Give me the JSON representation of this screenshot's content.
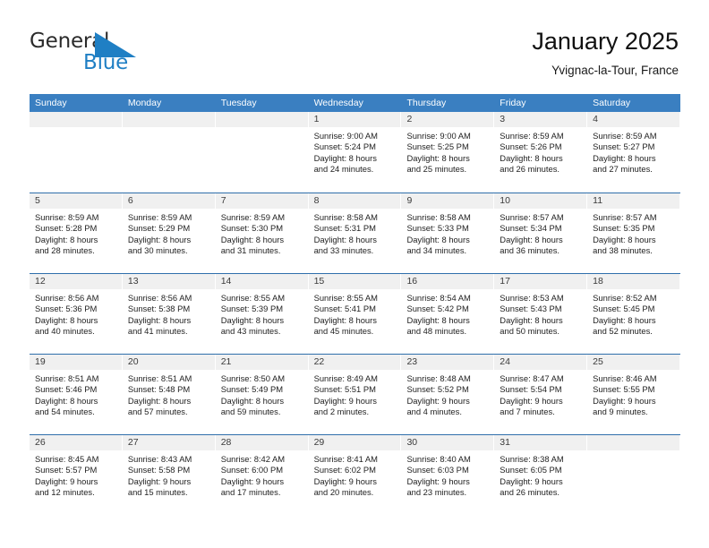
{
  "brand": {
    "name_part1": "General",
    "name_part2": "Blue",
    "triangle_color": "#1f7fc4",
    "text_color": "#2b2b2b"
  },
  "header": {
    "title": "January 2025",
    "location": "Yvignac-la-Tour, France"
  },
  "theme": {
    "header_blue": "#3a7fc1",
    "rule_blue": "#2f6fab",
    "band_gray": "#f0f0f0"
  },
  "weekdays": [
    "Sunday",
    "Monday",
    "Tuesday",
    "Wednesday",
    "Thursday",
    "Friday",
    "Saturday"
  ],
  "weeks": [
    [
      {
        "day": "",
        "lines": []
      },
      {
        "day": "",
        "lines": []
      },
      {
        "day": "",
        "lines": []
      },
      {
        "day": "1",
        "lines": [
          "Sunrise: 9:00 AM",
          "Sunset: 5:24 PM",
          "Daylight: 8 hours",
          "and 24 minutes."
        ]
      },
      {
        "day": "2",
        "lines": [
          "Sunrise: 9:00 AM",
          "Sunset: 5:25 PM",
          "Daylight: 8 hours",
          "and 25 minutes."
        ]
      },
      {
        "day": "3",
        "lines": [
          "Sunrise: 8:59 AM",
          "Sunset: 5:26 PM",
          "Daylight: 8 hours",
          "and 26 minutes."
        ]
      },
      {
        "day": "4",
        "lines": [
          "Sunrise: 8:59 AM",
          "Sunset: 5:27 PM",
          "Daylight: 8 hours",
          "and 27 minutes."
        ]
      }
    ],
    [
      {
        "day": "5",
        "lines": [
          "Sunrise: 8:59 AM",
          "Sunset: 5:28 PM",
          "Daylight: 8 hours",
          "and 28 minutes."
        ]
      },
      {
        "day": "6",
        "lines": [
          "Sunrise: 8:59 AM",
          "Sunset: 5:29 PM",
          "Daylight: 8 hours",
          "and 30 minutes."
        ]
      },
      {
        "day": "7",
        "lines": [
          "Sunrise: 8:59 AM",
          "Sunset: 5:30 PM",
          "Daylight: 8 hours",
          "and 31 minutes."
        ]
      },
      {
        "day": "8",
        "lines": [
          "Sunrise: 8:58 AM",
          "Sunset: 5:31 PM",
          "Daylight: 8 hours",
          "and 33 minutes."
        ]
      },
      {
        "day": "9",
        "lines": [
          "Sunrise: 8:58 AM",
          "Sunset: 5:33 PM",
          "Daylight: 8 hours",
          "and 34 minutes."
        ]
      },
      {
        "day": "10",
        "lines": [
          "Sunrise: 8:57 AM",
          "Sunset: 5:34 PM",
          "Daylight: 8 hours",
          "and 36 minutes."
        ]
      },
      {
        "day": "11",
        "lines": [
          "Sunrise: 8:57 AM",
          "Sunset: 5:35 PM",
          "Daylight: 8 hours",
          "and 38 minutes."
        ]
      }
    ],
    [
      {
        "day": "12",
        "lines": [
          "Sunrise: 8:56 AM",
          "Sunset: 5:36 PM",
          "Daylight: 8 hours",
          "and 40 minutes."
        ]
      },
      {
        "day": "13",
        "lines": [
          "Sunrise: 8:56 AM",
          "Sunset: 5:38 PM",
          "Daylight: 8 hours",
          "and 41 minutes."
        ]
      },
      {
        "day": "14",
        "lines": [
          "Sunrise: 8:55 AM",
          "Sunset: 5:39 PM",
          "Daylight: 8 hours",
          "and 43 minutes."
        ]
      },
      {
        "day": "15",
        "lines": [
          "Sunrise: 8:55 AM",
          "Sunset: 5:41 PM",
          "Daylight: 8 hours",
          "and 45 minutes."
        ]
      },
      {
        "day": "16",
        "lines": [
          "Sunrise: 8:54 AM",
          "Sunset: 5:42 PM",
          "Daylight: 8 hours",
          "and 48 minutes."
        ]
      },
      {
        "day": "17",
        "lines": [
          "Sunrise: 8:53 AM",
          "Sunset: 5:43 PM",
          "Daylight: 8 hours",
          "and 50 minutes."
        ]
      },
      {
        "day": "18",
        "lines": [
          "Sunrise: 8:52 AM",
          "Sunset: 5:45 PM",
          "Daylight: 8 hours",
          "and 52 minutes."
        ]
      }
    ],
    [
      {
        "day": "19",
        "lines": [
          "Sunrise: 8:51 AM",
          "Sunset: 5:46 PM",
          "Daylight: 8 hours",
          "and 54 minutes."
        ]
      },
      {
        "day": "20",
        "lines": [
          "Sunrise: 8:51 AM",
          "Sunset: 5:48 PM",
          "Daylight: 8 hours",
          "and 57 minutes."
        ]
      },
      {
        "day": "21",
        "lines": [
          "Sunrise: 8:50 AM",
          "Sunset: 5:49 PM",
          "Daylight: 8 hours",
          "and 59 minutes."
        ]
      },
      {
        "day": "22",
        "lines": [
          "Sunrise: 8:49 AM",
          "Sunset: 5:51 PM",
          "Daylight: 9 hours",
          "and 2 minutes."
        ]
      },
      {
        "day": "23",
        "lines": [
          "Sunrise: 8:48 AM",
          "Sunset: 5:52 PM",
          "Daylight: 9 hours",
          "and 4 minutes."
        ]
      },
      {
        "day": "24",
        "lines": [
          "Sunrise: 8:47 AM",
          "Sunset: 5:54 PM",
          "Daylight: 9 hours",
          "and 7 minutes."
        ]
      },
      {
        "day": "25",
        "lines": [
          "Sunrise: 8:46 AM",
          "Sunset: 5:55 PM",
          "Daylight: 9 hours",
          "and 9 minutes."
        ]
      }
    ],
    [
      {
        "day": "26",
        "lines": [
          "Sunrise: 8:45 AM",
          "Sunset: 5:57 PM",
          "Daylight: 9 hours",
          "and 12 minutes."
        ]
      },
      {
        "day": "27",
        "lines": [
          "Sunrise: 8:43 AM",
          "Sunset: 5:58 PM",
          "Daylight: 9 hours",
          "and 15 minutes."
        ]
      },
      {
        "day": "28",
        "lines": [
          "Sunrise: 8:42 AM",
          "Sunset: 6:00 PM",
          "Daylight: 9 hours",
          "and 17 minutes."
        ]
      },
      {
        "day": "29",
        "lines": [
          "Sunrise: 8:41 AM",
          "Sunset: 6:02 PM",
          "Daylight: 9 hours",
          "and 20 minutes."
        ]
      },
      {
        "day": "30",
        "lines": [
          "Sunrise: 8:40 AM",
          "Sunset: 6:03 PM",
          "Daylight: 9 hours",
          "and 23 minutes."
        ]
      },
      {
        "day": "31",
        "lines": [
          "Sunrise: 8:38 AM",
          "Sunset: 6:05 PM",
          "Daylight: 9 hours",
          "and 26 minutes."
        ]
      },
      {
        "day": "",
        "lines": []
      }
    ]
  ]
}
